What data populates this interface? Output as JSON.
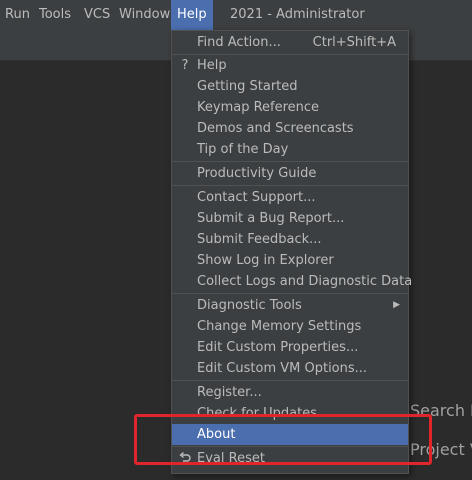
{
  "menubar": {
    "items": [
      {
        "label": "Run"
      },
      {
        "label": "Tools"
      },
      {
        "label": "VCS"
      },
      {
        "label": "Window"
      },
      {
        "label": "Help"
      }
    ],
    "title": "2021 - Administrator"
  },
  "background_hints": {
    "search": "Search E",
    "project": "Project V"
  },
  "help_menu": {
    "items": [
      {
        "label": "Find Action...",
        "shortcut": "Ctrl+Shift+A"
      },
      {
        "label": "Help",
        "icon": "question-mark-icon"
      },
      {
        "label": "Getting Started"
      },
      {
        "label": "Keymap Reference"
      },
      {
        "label": "Demos and Screencasts"
      },
      {
        "label": "Tip of the Day"
      },
      {
        "label": "Productivity Guide"
      },
      {
        "label": "Contact Support..."
      },
      {
        "label": "Submit a Bug Report..."
      },
      {
        "label": "Submit Feedback..."
      },
      {
        "label": "Show Log in Explorer"
      },
      {
        "label": "Collect Logs and Diagnostic Data"
      },
      {
        "label": "Diagnostic Tools",
        "submenu": true
      },
      {
        "label": "Change Memory Settings"
      },
      {
        "label": "Edit Custom Properties..."
      },
      {
        "label": "Edit Custom VM Options..."
      },
      {
        "label": "Register..."
      },
      {
        "label": "Check for Updates..."
      },
      {
        "label": "About",
        "selected": true
      },
      {
        "label": "Eval Reset",
        "icon": "undo-arrow-icon"
      }
    ]
  },
  "colors": {
    "menu_bg": "#3c3f41",
    "selection": "#4b6eaf",
    "highlight_box": "#e0262b",
    "editor_bg": "#2b2b2b"
  }
}
